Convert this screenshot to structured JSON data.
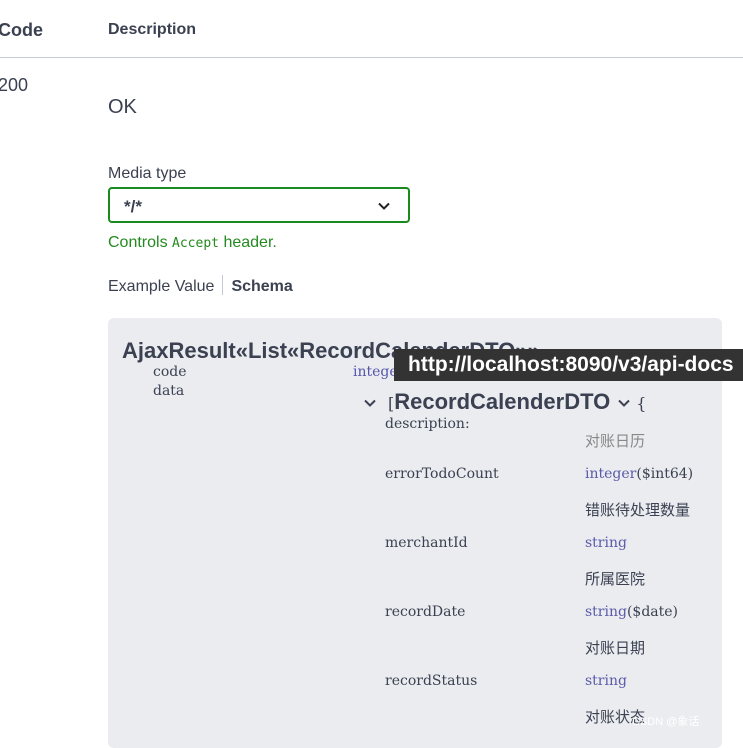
{
  "table_header": {
    "code": "Code",
    "description": "Description"
  },
  "response": {
    "code": "200",
    "status_text": "OK",
    "media_type_label": "Media type",
    "media_type_value": "*/*",
    "controls_prefix": "Controls",
    "controls_code": "Accept",
    "controls_suffix": "header."
  },
  "tabs": {
    "example_value": "Example Value",
    "schema": "Schema"
  },
  "schema": {
    "model_title": "AjaxResult«List«RecordCalenderDTO»»",
    "properties": {
      "code": {
        "name": "code",
        "type": "integer"
      },
      "data": {
        "name": "data"
      }
    },
    "sub_model": {
      "open_bracket": "[",
      "title": "RecordCalenderDTO",
      "brace": "{",
      "description_label": "description:",
      "description_value": "对账日历",
      "fields": [
        {
          "name": "errorTodoCount",
          "type": "integer",
          "format": "($int64)",
          "desc": "错账待处理数量"
        },
        {
          "name": "merchantId",
          "type": "string",
          "format": "",
          "desc": "所属医院"
        },
        {
          "name": "recordDate",
          "type": "string",
          "format": "($date)",
          "desc": "对账日期"
        },
        {
          "name": "recordStatus",
          "type": "string",
          "format": "",
          "desc": "对账状态"
        }
      ]
    }
  },
  "tooltip_url": "http://localhost:8090/v3/api-docs",
  "watermark": "CSDN @象话",
  "colors": {
    "accent_green": "#1a8a1f",
    "text": "#3b4151",
    "panel": "#eaecf0",
    "type_blue": "#5a5aa8"
  }
}
